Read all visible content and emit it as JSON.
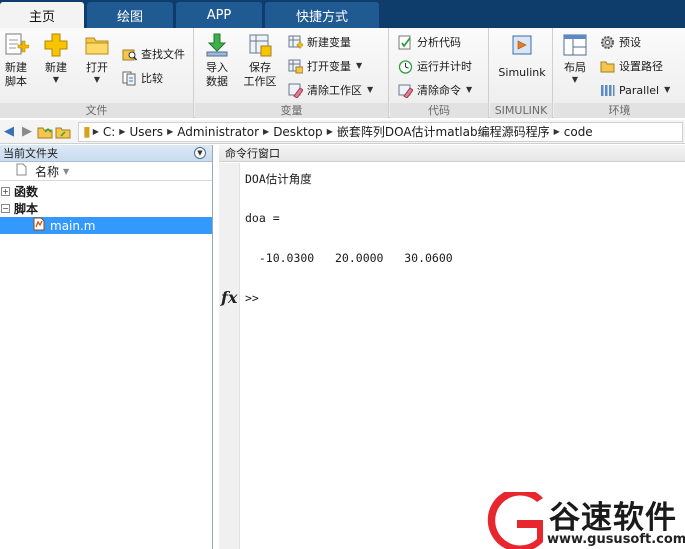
{
  "tabs": [
    {
      "label": "主页",
      "active": true
    },
    {
      "label": "绘图",
      "active": false
    },
    {
      "label": "APP",
      "active": false
    },
    {
      "label": "快捷方式",
      "active": false
    }
  ],
  "ribbon": {
    "file": {
      "group_label": "文件",
      "new_script": "新建\n脚本",
      "new": "新建",
      "open": "打开",
      "find_files": "查找文件",
      "compare": "比较"
    },
    "variable": {
      "group_label": "变量",
      "import_data": "导入\n数据",
      "save_workspace": "保存\n工作区",
      "new_variable": "新建变量",
      "open_variable": "打开变量",
      "clear_workspace": "清除工作区"
    },
    "code": {
      "group_label": "代码",
      "analyze_code": "分析代码",
      "run_and_time": "运行并计时",
      "clear_commands": "清除命令"
    },
    "simulink": {
      "group_label": "SIMULINK",
      "simulink": "Simulink"
    },
    "environment": {
      "group_label": "环境",
      "layout": "布局",
      "preferences": "预设",
      "set_path": "设置路径",
      "parallel": "Parallel"
    }
  },
  "address": {
    "crumbs": [
      "C:",
      "Users",
      "Administrator",
      "Desktop",
      "嵌套阵列DOA估计matlab编程源码程序",
      "code"
    ]
  },
  "current_folder": {
    "title": "当前文件夹",
    "column_name": "名称",
    "tree": [
      {
        "label": "函数",
        "type": "group",
        "expanded": false
      },
      {
        "label": "脚本",
        "type": "group",
        "expanded": true
      },
      {
        "label": "main.m",
        "type": "file",
        "selected": true
      }
    ]
  },
  "command_window": {
    "title": "命令行窗口",
    "lines": [
      "DOA估计角度",
      "doa =",
      "  -10.0300   20.0000   30.0600"
    ],
    "prompt": ">>",
    "fx_label": "fx"
  },
  "watermark": {
    "brand": "谷速软件",
    "url": "www.gususoft.com"
  },
  "colors": {
    "tab_bar": "#0e3d6b",
    "tab_inactive": "#1f5a92",
    "selection": "#3399ff",
    "watermark_red": "#e8262d"
  }
}
